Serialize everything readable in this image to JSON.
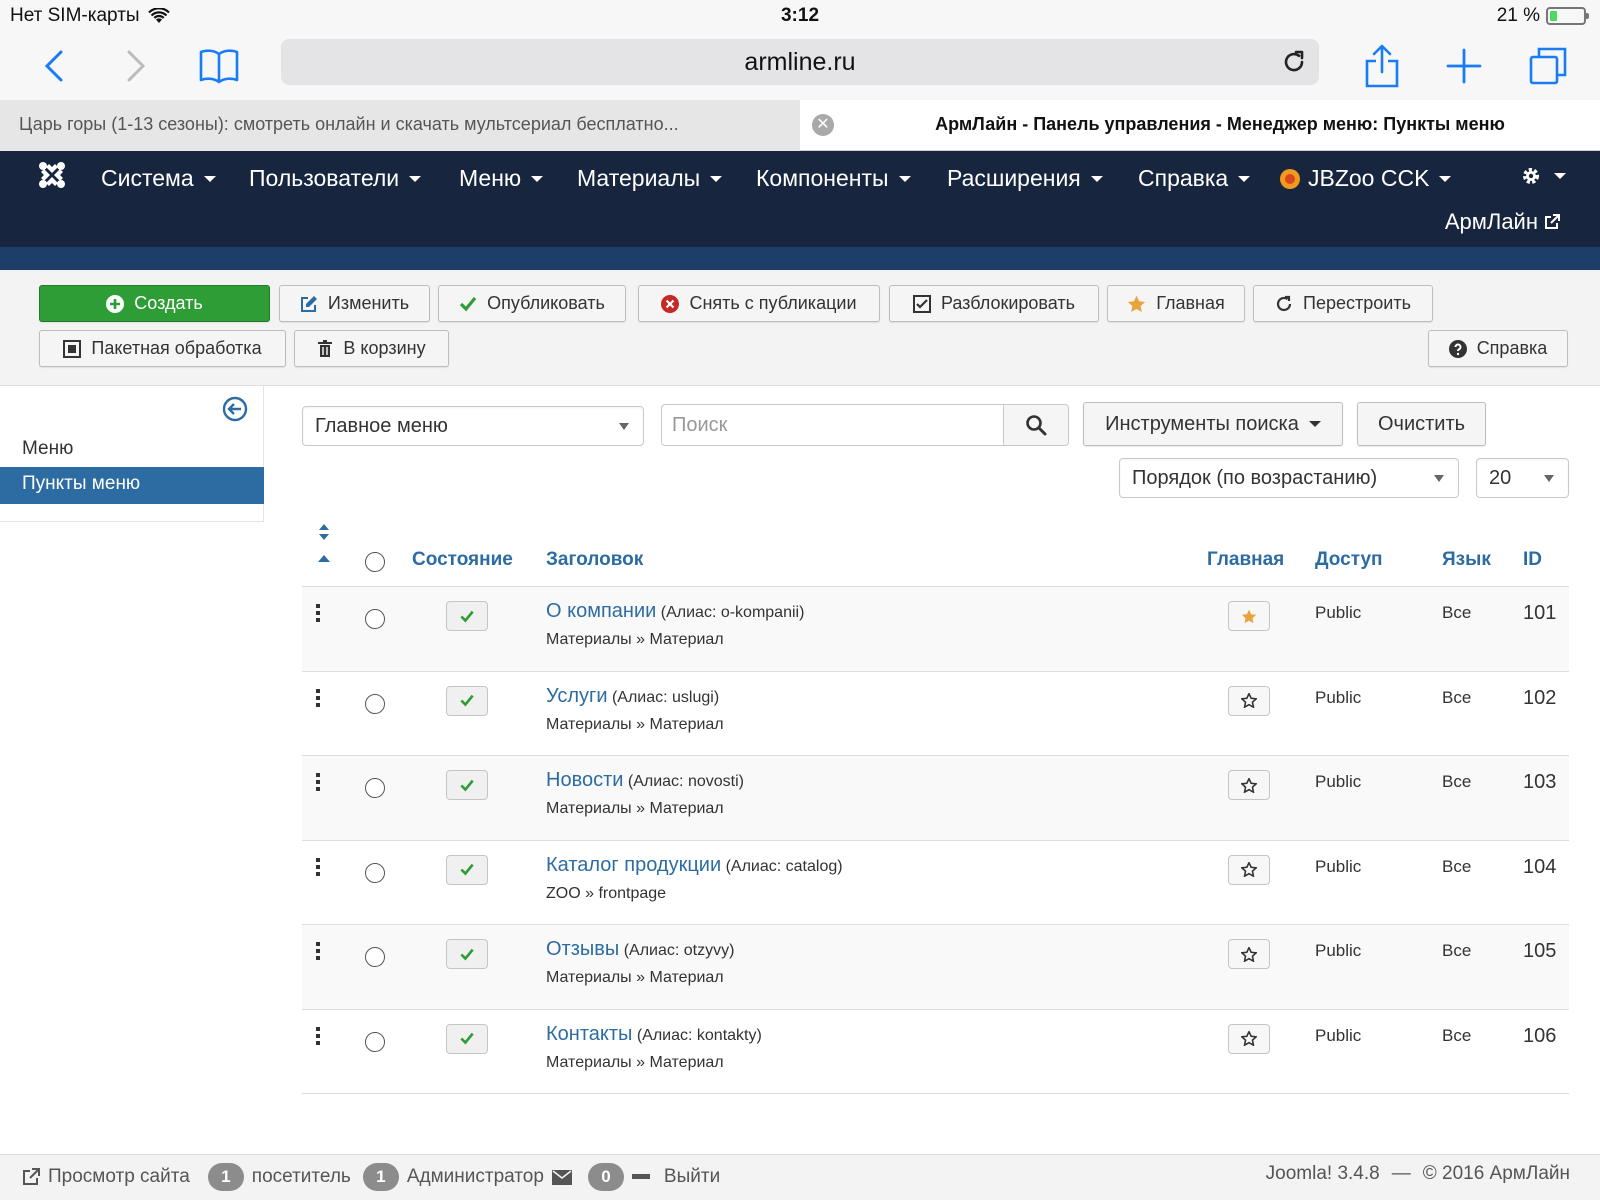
{
  "status_bar": {
    "carrier": "Нет SIM-карты",
    "time": "3:12",
    "battery": "21 %",
    "battery_level": 0.21
  },
  "browser": {
    "url": "armline.ru",
    "tabs": [
      {
        "label": "Царь горы (1-13 сезоны): смотреть онлайн и скачать мультсериал бесплатно...",
        "active": false
      },
      {
        "label": "АрмЛайн - Панель управления - Менеджер меню: Пункты меню",
        "active": true
      }
    ],
    "close_glyph": "✕"
  },
  "topnav": {
    "items": [
      "Система",
      "Пользователи",
      "Меню",
      "Материалы",
      "Компоненты",
      "Расширения",
      "Справка",
      "JBZoo CCK"
    ],
    "user": "АрмЛайн"
  },
  "toolbar": {
    "create": "Создать",
    "edit": "Изменить",
    "publish": "Опубликовать",
    "unpublish": "Снять с публикации",
    "checkin": "Разблокировать",
    "home": "Главная",
    "rebuild": "Перестроить",
    "batch": "Пакетная обработка",
    "trash": "В корзину",
    "help": "Справка"
  },
  "sidebar": {
    "items": [
      {
        "label": "Меню",
        "active": false
      },
      {
        "label": "Пункты меню",
        "active": true
      }
    ]
  },
  "filters": {
    "menu_select": "Главное меню",
    "search_placeholder": "Поиск",
    "search_tools": "Инструменты поиска",
    "clear": "Очистить",
    "ordering": "Порядок (по возрастанию)",
    "limit": "20"
  },
  "table": {
    "headers": {
      "status": "Состояние",
      "title": "Заголовок",
      "home": "Главная",
      "access": "Доступ",
      "language": "Язык",
      "id": "ID"
    },
    "rows": [
      {
        "title": "О компании",
        "alias": "(Алиас: o-kompanii)",
        "type": "Материалы » Материал",
        "home": true,
        "access": "Public",
        "language": "Все",
        "id": "101"
      },
      {
        "title": "Услуги",
        "alias": "(Алиас: uslugi)",
        "type": "Материалы » Материал",
        "home": false,
        "access": "Public",
        "language": "Все",
        "id": "102"
      },
      {
        "title": "Новости",
        "alias": "(Алиас: novosti)",
        "type": "Материалы » Материал",
        "home": false,
        "access": "Public",
        "language": "Все",
        "id": "103"
      },
      {
        "title": "Каталог продукции",
        "alias": "(Алиас: catalog)",
        "type": "ZOO » frontpage",
        "home": false,
        "access": "Public",
        "language": "Все",
        "id": "104"
      },
      {
        "title": "Отзывы",
        "alias": "(Алиас: otzyvy)",
        "type": "Материалы » Материал",
        "home": false,
        "access": "Public",
        "language": "Все",
        "id": "105"
      },
      {
        "title": "Контакты",
        "alias": "(Алиас: kontakty)",
        "type": "Материалы » Материал",
        "home": false,
        "access": "Public",
        "language": "Все",
        "id": "106"
      }
    ]
  },
  "footer": {
    "view_site": "Просмотр сайта",
    "visitors_count": "1",
    "visitors_label": "посетитель",
    "admins_count": "1",
    "admins_label": "Администратор",
    "messages_count": "0",
    "logout": "Выйти",
    "version": "Joomla! 3.4.8",
    "separator": "—",
    "copyright": "© 2016 АрмЛайн"
  },
  "colors": {
    "nav_bg": "#18253f",
    "accent": "#2d6ca2",
    "success": "#2f9d36",
    "star": "#e8a33c"
  }
}
